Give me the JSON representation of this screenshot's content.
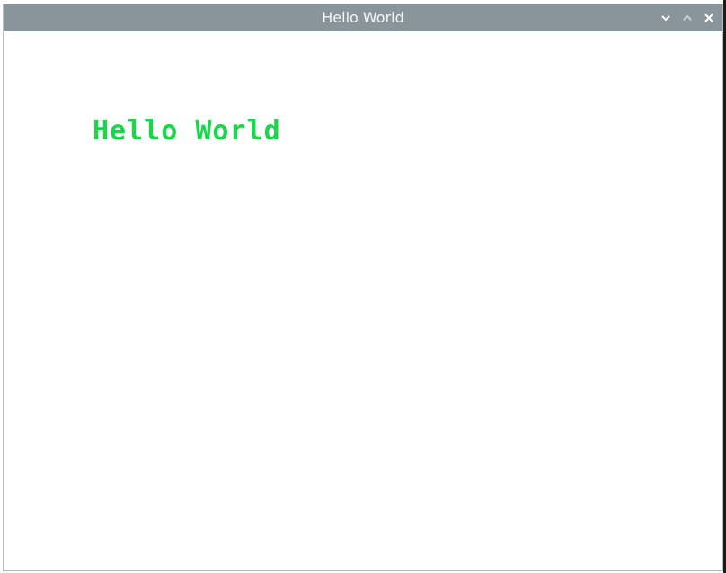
{
  "window": {
    "title": "Hello World"
  },
  "content": {
    "label_text": "Hello World"
  },
  "icons": {
    "minimize": "chevron-down-icon",
    "maximize": "chevron-up-icon",
    "close": "close-icon"
  },
  "colors": {
    "titlebar": "#8a949b",
    "title_text": "#f4f6f7",
    "label_text": "#19d64a",
    "background": "#ffffff"
  }
}
